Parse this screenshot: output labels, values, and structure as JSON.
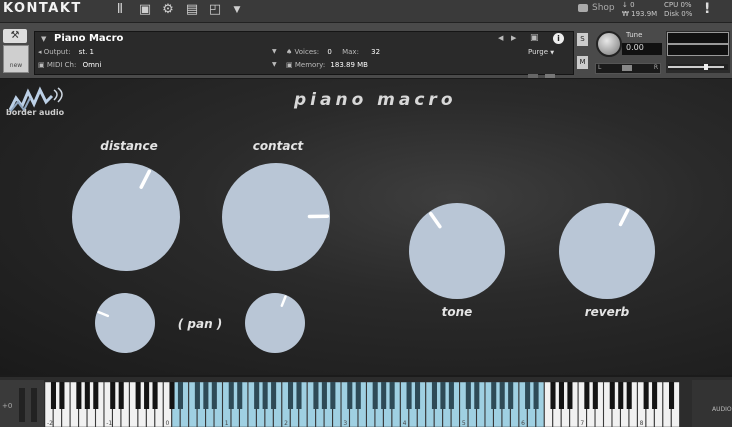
{
  "app": {
    "logo": "KONTAKT",
    "toolbar_icons": [
      "library-icon",
      "save-icon",
      "gear-icon",
      "view-icon",
      "resize-icon",
      "dropdown-icon"
    ],
    "shop_label": "Shop",
    "stats": {
      "line1": "↓ 0",
      "line2": "₩ 193.9M",
      "cpu": "CPU 0%",
      "disk": "Disk 0%"
    },
    "warning": "!"
  },
  "instrument": {
    "name": "Piano Macro",
    "output_label": "Output:",
    "output_value": "st. 1",
    "midi_label": "MIDI Ch:",
    "midi_value": "Omni",
    "voices_label": "Voices:",
    "voices_value": "0",
    "max_label": "Max:",
    "max_value": "32",
    "memory_label": "Memory:",
    "memory_value": "183.89 MB",
    "purge_label": "Purge",
    "tune_label": "Tune",
    "tune_value": "0.00",
    "solo_label": "S",
    "mute_label": "M",
    "pan_l": "L",
    "pan_r": "R",
    "new_label": "new"
  },
  "ui": {
    "brand": "border audio",
    "title": "piano macro",
    "knobs": [
      {
        "id": "distance",
        "label": "distance",
        "value": 0.6
      },
      {
        "id": "contact",
        "label": "contact",
        "value": 0.83
      },
      {
        "id": "pan-left",
        "label": "",
        "value": 0.25
      },
      {
        "id": "pan-right",
        "label": "",
        "value": 0.58
      },
      {
        "id": "tone",
        "label": "tone",
        "value": 0.37
      },
      {
        "id": "reverb",
        "label": "reverb",
        "value": 0.6
      }
    ],
    "pan_caption": "( pan )"
  },
  "keyboard": {
    "octave_labels": [
      "-2",
      "-1",
      "0",
      "1",
      "2",
      "3",
      "4",
      "5",
      "6",
      "7",
      "8"
    ],
    "pitch_label": "+0",
    "right_label": "AUDIO"
  }
}
